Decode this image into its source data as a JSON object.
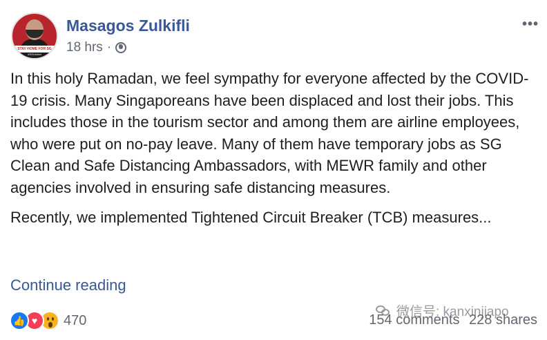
{
  "post": {
    "author": "Masagos Zulkifli",
    "time": "18 hrs",
    "separator": "·",
    "visibility_icon": "globe-icon",
    "more_icon": "•••",
    "avatar_banner": "STAY HOME FOR SG",
    "avatar_tag": "#SGUnited",
    "paragraphs": [
      "In this holy Ramadan, we feel sympathy for everyone affected by the COVID-19 crisis. Many Singaporeans have been displaced and lost their jobs. This includes those in the tourism sector and among them are airline employees, who were put on no-pay leave. Many of them have temporary jobs as SG Clean and Safe Distancing Ambassadors, with MEWR family and other agencies involved in ensuring safe distancing measures.",
      "Recently, we implemented Tightened Circuit Breaker (TCB) measures..."
    ],
    "continue_label": "Continue reading"
  },
  "footer": {
    "reaction_icons": [
      "like-icon",
      "love-icon",
      "wow-icon"
    ],
    "reaction_count": "470",
    "comments": "154 comments",
    "shares": "228 shares"
  },
  "watermark": {
    "text": "微信号: kanxinjiapo"
  },
  "colors": {
    "link": "#385898",
    "text": "#1c1e21",
    "muted": "#606770",
    "like": "#1877f2",
    "love": "#f33e58",
    "wow": "#f7b125"
  }
}
